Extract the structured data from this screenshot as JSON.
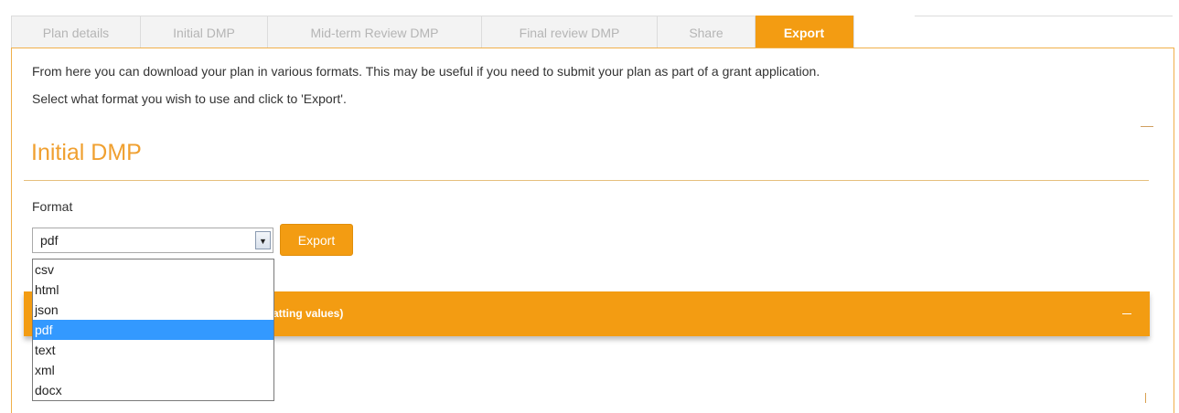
{
  "tabs": [
    {
      "label": "Plan details",
      "active": false
    },
    {
      "label": "Initial DMP",
      "active": false
    },
    {
      "label": "Mid-term Review DMP",
      "active": false
    },
    {
      "label": "Final review DMP",
      "active": false
    },
    {
      "label": "Share",
      "active": false
    },
    {
      "label": "Export",
      "active": true
    }
  ],
  "intro": {
    "line1": "From here you can download your plan in various formats. This may be useful if you need to submit your plan as part of a grant application.",
    "line2": "Select what format you wish to use and click to 'Export'."
  },
  "section": {
    "title": "Initial DMP",
    "collapse_symbol": "—"
  },
  "format": {
    "label": "Format",
    "selected": "pdf",
    "options": [
      "csv",
      "html",
      "json",
      "pdf",
      "text",
      "xml",
      "docx"
    ]
  },
  "export_button": "Export",
  "formatting_bar": {
    "text": "atting values)",
    "collapse_symbol": "—"
  },
  "colors": {
    "accent": "#f39c12",
    "selection": "#3399ff"
  }
}
